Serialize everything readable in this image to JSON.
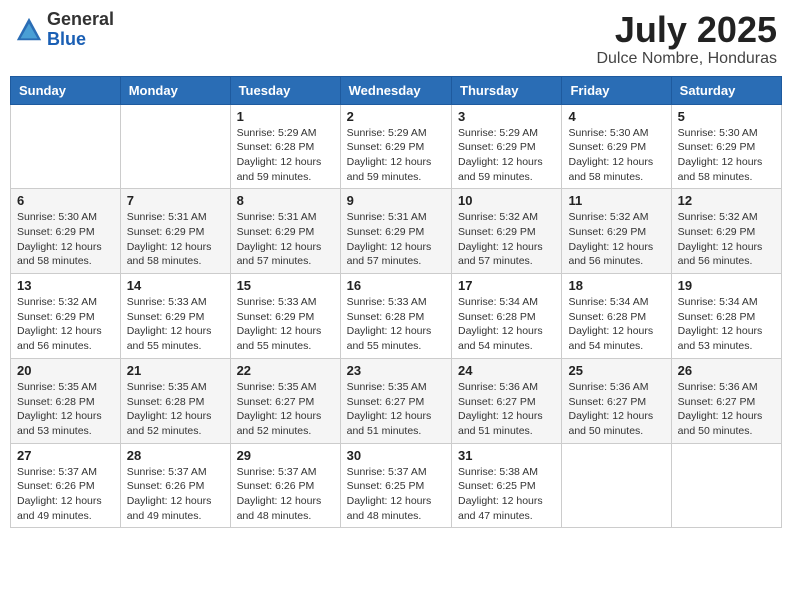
{
  "logo": {
    "general": "General",
    "blue": "Blue"
  },
  "title": {
    "month_year": "July 2025",
    "location": "Dulce Nombre, Honduras"
  },
  "days_of_week": [
    "Sunday",
    "Monday",
    "Tuesday",
    "Wednesday",
    "Thursday",
    "Friday",
    "Saturday"
  ],
  "weeks": [
    [
      {
        "day": "",
        "info": ""
      },
      {
        "day": "",
        "info": ""
      },
      {
        "day": "1",
        "info": "Sunrise: 5:29 AM\nSunset: 6:28 PM\nDaylight: 12 hours and 59 minutes."
      },
      {
        "day": "2",
        "info": "Sunrise: 5:29 AM\nSunset: 6:29 PM\nDaylight: 12 hours and 59 minutes."
      },
      {
        "day": "3",
        "info": "Sunrise: 5:29 AM\nSunset: 6:29 PM\nDaylight: 12 hours and 59 minutes."
      },
      {
        "day": "4",
        "info": "Sunrise: 5:30 AM\nSunset: 6:29 PM\nDaylight: 12 hours and 58 minutes."
      },
      {
        "day": "5",
        "info": "Sunrise: 5:30 AM\nSunset: 6:29 PM\nDaylight: 12 hours and 58 minutes."
      }
    ],
    [
      {
        "day": "6",
        "info": "Sunrise: 5:30 AM\nSunset: 6:29 PM\nDaylight: 12 hours and 58 minutes."
      },
      {
        "day": "7",
        "info": "Sunrise: 5:31 AM\nSunset: 6:29 PM\nDaylight: 12 hours and 58 minutes."
      },
      {
        "day": "8",
        "info": "Sunrise: 5:31 AM\nSunset: 6:29 PM\nDaylight: 12 hours and 57 minutes."
      },
      {
        "day": "9",
        "info": "Sunrise: 5:31 AM\nSunset: 6:29 PM\nDaylight: 12 hours and 57 minutes."
      },
      {
        "day": "10",
        "info": "Sunrise: 5:32 AM\nSunset: 6:29 PM\nDaylight: 12 hours and 57 minutes."
      },
      {
        "day": "11",
        "info": "Sunrise: 5:32 AM\nSunset: 6:29 PM\nDaylight: 12 hours and 56 minutes."
      },
      {
        "day": "12",
        "info": "Sunrise: 5:32 AM\nSunset: 6:29 PM\nDaylight: 12 hours and 56 minutes."
      }
    ],
    [
      {
        "day": "13",
        "info": "Sunrise: 5:32 AM\nSunset: 6:29 PM\nDaylight: 12 hours and 56 minutes."
      },
      {
        "day": "14",
        "info": "Sunrise: 5:33 AM\nSunset: 6:29 PM\nDaylight: 12 hours and 55 minutes."
      },
      {
        "day": "15",
        "info": "Sunrise: 5:33 AM\nSunset: 6:29 PM\nDaylight: 12 hours and 55 minutes."
      },
      {
        "day": "16",
        "info": "Sunrise: 5:33 AM\nSunset: 6:28 PM\nDaylight: 12 hours and 55 minutes."
      },
      {
        "day": "17",
        "info": "Sunrise: 5:34 AM\nSunset: 6:28 PM\nDaylight: 12 hours and 54 minutes."
      },
      {
        "day": "18",
        "info": "Sunrise: 5:34 AM\nSunset: 6:28 PM\nDaylight: 12 hours and 54 minutes."
      },
      {
        "day": "19",
        "info": "Sunrise: 5:34 AM\nSunset: 6:28 PM\nDaylight: 12 hours and 53 minutes."
      }
    ],
    [
      {
        "day": "20",
        "info": "Sunrise: 5:35 AM\nSunset: 6:28 PM\nDaylight: 12 hours and 53 minutes."
      },
      {
        "day": "21",
        "info": "Sunrise: 5:35 AM\nSunset: 6:28 PM\nDaylight: 12 hours and 52 minutes."
      },
      {
        "day": "22",
        "info": "Sunrise: 5:35 AM\nSunset: 6:27 PM\nDaylight: 12 hours and 52 minutes."
      },
      {
        "day": "23",
        "info": "Sunrise: 5:35 AM\nSunset: 6:27 PM\nDaylight: 12 hours and 51 minutes."
      },
      {
        "day": "24",
        "info": "Sunrise: 5:36 AM\nSunset: 6:27 PM\nDaylight: 12 hours and 51 minutes."
      },
      {
        "day": "25",
        "info": "Sunrise: 5:36 AM\nSunset: 6:27 PM\nDaylight: 12 hours and 50 minutes."
      },
      {
        "day": "26",
        "info": "Sunrise: 5:36 AM\nSunset: 6:27 PM\nDaylight: 12 hours and 50 minutes."
      }
    ],
    [
      {
        "day": "27",
        "info": "Sunrise: 5:37 AM\nSunset: 6:26 PM\nDaylight: 12 hours and 49 minutes."
      },
      {
        "day": "28",
        "info": "Sunrise: 5:37 AM\nSunset: 6:26 PM\nDaylight: 12 hours and 49 minutes."
      },
      {
        "day": "29",
        "info": "Sunrise: 5:37 AM\nSunset: 6:26 PM\nDaylight: 12 hours and 48 minutes."
      },
      {
        "day": "30",
        "info": "Sunrise: 5:37 AM\nSunset: 6:25 PM\nDaylight: 12 hours and 48 minutes."
      },
      {
        "day": "31",
        "info": "Sunrise: 5:38 AM\nSunset: 6:25 PM\nDaylight: 12 hours and 47 minutes."
      },
      {
        "day": "",
        "info": ""
      },
      {
        "day": "",
        "info": ""
      }
    ]
  ]
}
